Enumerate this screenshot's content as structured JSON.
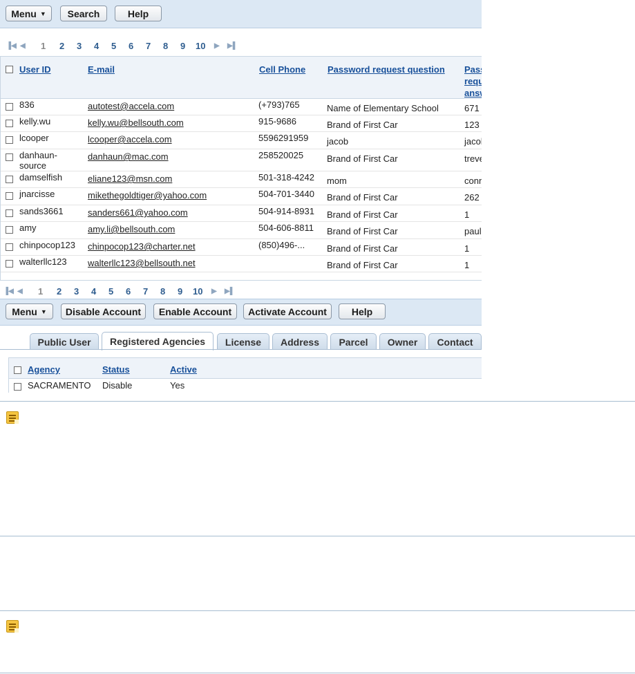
{
  "toolbar_top": {
    "menu": "Menu",
    "search": "Search",
    "help": "Help"
  },
  "pager": {
    "pages": [
      "1",
      "2",
      "3",
      "4",
      "5",
      "6",
      "7",
      "8",
      "9",
      "10"
    ],
    "current": "1"
  },
  "columns": {
    "user_id": "User ID",
    "email": "E-mail",
    "cell_phone": "Cell Phone",
    "question": "Password request question",
    "answer": "Password request answer"
  },
  "rows": [
    {
      "user_id": "836",
      "email": "autotest@accela.com",
      "phone": "(+793)765",
      "question": "Name of Elementary School",
      "answer": "671"
    },
    {
      "user_id": "kelly.wu",
      "email": "kelly.wu@bellsouth.com",
      "phone": "915-9686",
      "question": "Brand of First Car",
      "answer": "123"
    },
    {
      "user_id": "lcooper",
      "email": "lcooper@accela.com",
      "phone": "5596291959",
      "question": "jacob",
      "answer": "jacob"
    },
    {
      "user_id": "danhaun-\nsource",
      "email": "danhaun@mac.com",
      "phone": "258520025",
      "question": "Brand of First Car",
      "answer": "treve"
    },
    {
      "user_id": "damselfish",
      "email": "eliane123@msn.com",
      "phone": "501-318-4242",
      "question": "mom",
      "answer": "conn"
    },
    {
      "user_id": "jnarcisse",
      "email": "mikethegoldtiger@yahoo.com",
      "phone": "504-701-3440",
      "question": "Brand of First Car",
      "answer": "262"
    },
    {
      "user_id": "sands3661",
      "email": "sanders661@yahoo.com",
      "phone": "504-914-8931",
      "question": "Brand of First Car",
      "answer": "1"
    },
    {
      "user_id": "amy",
      "email": "amy.li@bellsouth.com",
      "phone": "504-606-8811",
      "question": "Brand of First Car",
      "answer": "pauli"
    },
    {
      "user_id": "chinpocop123",
      "email": "chinpocop123@charter.net",
      "phone": "(850)496-...",
      "question": "Brand of First Car",
      "answer": "1"
    },
    {
      "user_id": "walterllc123",
      "email": "walterllc123@bellsouth.net",
      "phone": "",
      "question": "Brand of First Car",
      "answer": "1"
    }
  ],
  "toolbar_bottom": {
    "menu": "Menu",
    "disable": "Disable Account",
    "enable": "Enable Account",
    "activate": "Activate Account",
    "help": "Help"
  },
  "tabs": [
    "Public User",
    "Registered Agencies",
    "License",
    "Address",
    "Parcel",
    "Owner",
    "Contact"
  ],
  "agency_columns": {
    "agency": "Agency",
    "status": "Status",
    "active": "Active"
  },
  "agency_rows": [
    {
      "agency": "SACRAMENTO",
      "status": "Disable",
      "active": "Yes"
    }
  ]
}
